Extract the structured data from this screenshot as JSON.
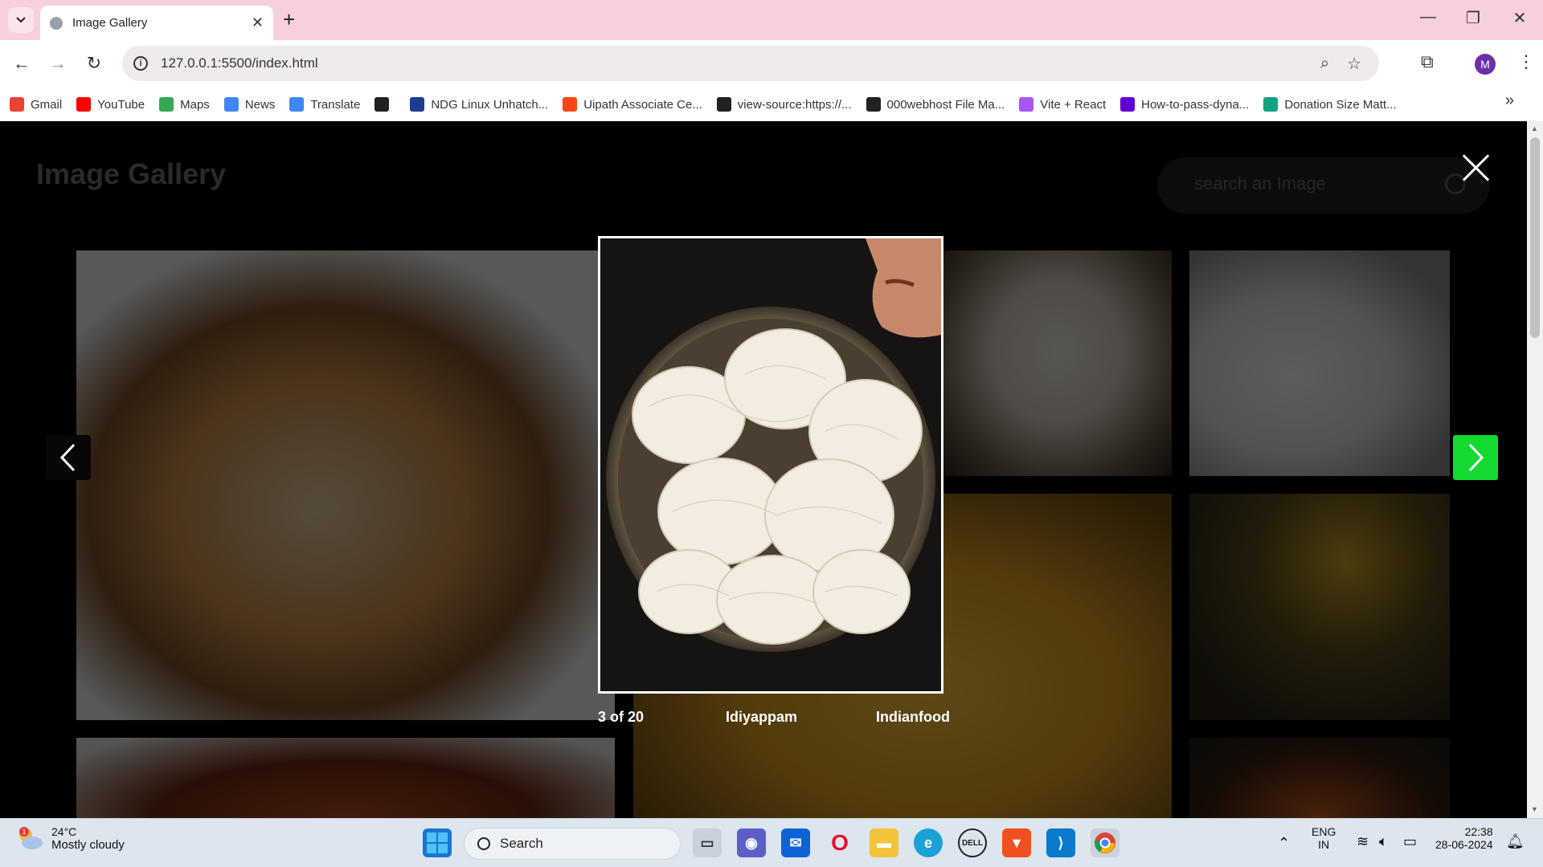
{
  "browser": {
    "tab_title": "Image Gallery",
    "url": "127.0.0.1:5500/index.html",
    "profile_initial": "M"
  },
  "bookmarks": [
    {
      "label": "Gmail",
      "color": "#ea4335"
    },
    {
      "label": "YouTube",
      "color": "#ff0000"
    },
    {
      "label": "Maps",
      "color": "#34a853"
    },
    {
      "label": "News",
      "color": "#4285f4"
    },
    {
      "label": "Translate",
      "color": "#4285f4"
    },
    {
      "label": "",
      "color": "#202124"
    },
    {
      "label": "NDG Linux Unhatch...",
      "color": "#1a3d8f"
    },
    {
      "label": "Uipath Associate Ce...",
      "color": "#fa4616"
    },
    {
      "label": "view-source:https://...",
      "color": "#202124"
    },
    {
      "label": "000webhost File Ma...",
      "color": "#202124"
    },
    {
      "label": "Vite + React",
      "color": "#a855f7"
    },
    {
      "label": "How-to-pass-dyna...",
      "color": "#6001d2"
    },
    {
      "label": "Donation Size Matt...",
      "color": "#10a37f"
    }
  ],
  "page": {
    "title": "Image Gallery",
    "search_placeholder": "search an Image"
  },
  "lightbox": {
    "position": "3 of 20",
    "image_name": "Idiyappam",
    "category": "Indianfood"
  },
  "taskbar": {
    "weather_temp": "24°C",
    "weather_desc": "Mostly cloudy",
    "weather_badge": "1",
    "search_label": "Search",
    "lang_top": "ENG",
    "lang_bottom": "IN",
    "time": "22:38",
    "date": "28-06-2024"
  }
}
